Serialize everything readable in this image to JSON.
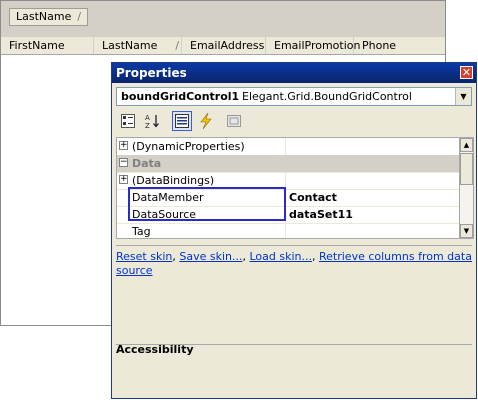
{
  "grid": {
    "group_chip": "LastName",
    "group_sep": "/",
    "columns": [
      {
        "label": "FirstName",
        "sep": ""
      },
      {
        "label": "LastName",
        "sep": "/"
      },
      {
        "label": "EmailAddress",
        "sep": ""
      },
      {
        "label": "EmailPromotion",
        "sep": ""
      },
      {
        "label": "Phone",
        "sep": ""
      }
    ]
  },
  "properties": {
    "title": "Properties",
    "close_glyph": "✕",
    "selector": {
      "name": "boundGridControl1",
      "type": "Elegant.Grid.BoundGridControl",
      "arrow": "▼"
    },
    "rows": [
      {
        "expander": "+",
        "name": "(DynamicProperties)",
        "value": "",
        "kind": "item"
      },
      {
        "expander": "−",
        "name": "Data",
        "value": "",
        "kind": "category"
      },
      {
        "expander": "+",
        "name": "(DataBindings)",
        "value": "",
        "kind": "item"
      },
      {
        "expander": "",
        "name": "DataMember",
        "value": "Contact",
        "kind": "item"
      },
      {
        "expander": "",
        "name": "DataSource",
        "value": "dataSet11",
        "kind": "item"
      },
      {
        "expander": "",
        "name": "Tag",
        "value": "",
        "kind": "item"
      }
    ],
    "commands": {
      "reset": "Reset skin",
      "save": "Save skin...",
      "load": "Load skin...",
      "retrieve": "Retrieve columns from data source",
      "sep": ", "
    },
    "description_title": "Accessibility"
  }
}
